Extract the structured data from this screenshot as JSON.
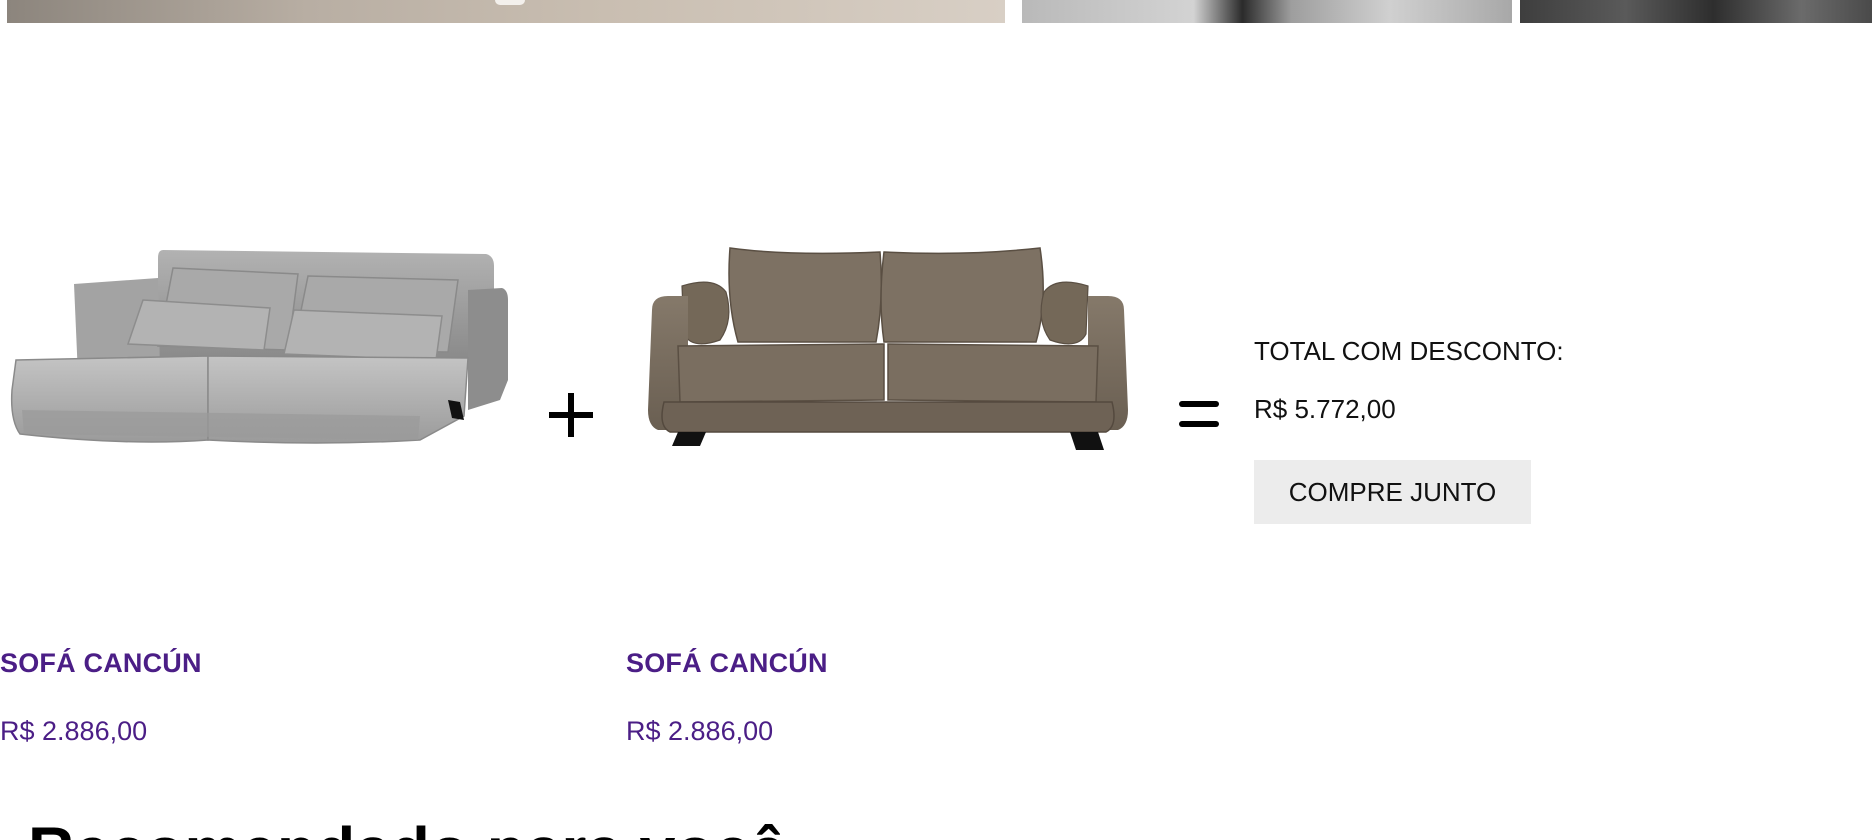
{
  "colors": {
    "product_text": "#4b1e86",
    "button_bg": "#ececec",
    "text": "#111111"
  },
  "products": [
    {
      "name": "SOFÁ CANCÚN",
      "price": "R$ 2.886,00",
      "image_icon": "gray-sofa-bed-image"
    },
    {
      "name": "SOFÁ CANCÚN",
      "price": "R$ 2.886,00",
      "image_icon": "brown-sofa-image"
    }
  ],
  "operators": {
    "plus_icon": "plus-icon",
    "equals_icon": "equals-icon"
  },
  "bundle": {
    "total_label": "TOTAL COM DESCONTO:",
    "total_price": "R$ 5.772,00",
    "button_label": "COMPRE JUNTO"
  },
  "section": {
    "heading": "Recomendado para você"
  }
}
